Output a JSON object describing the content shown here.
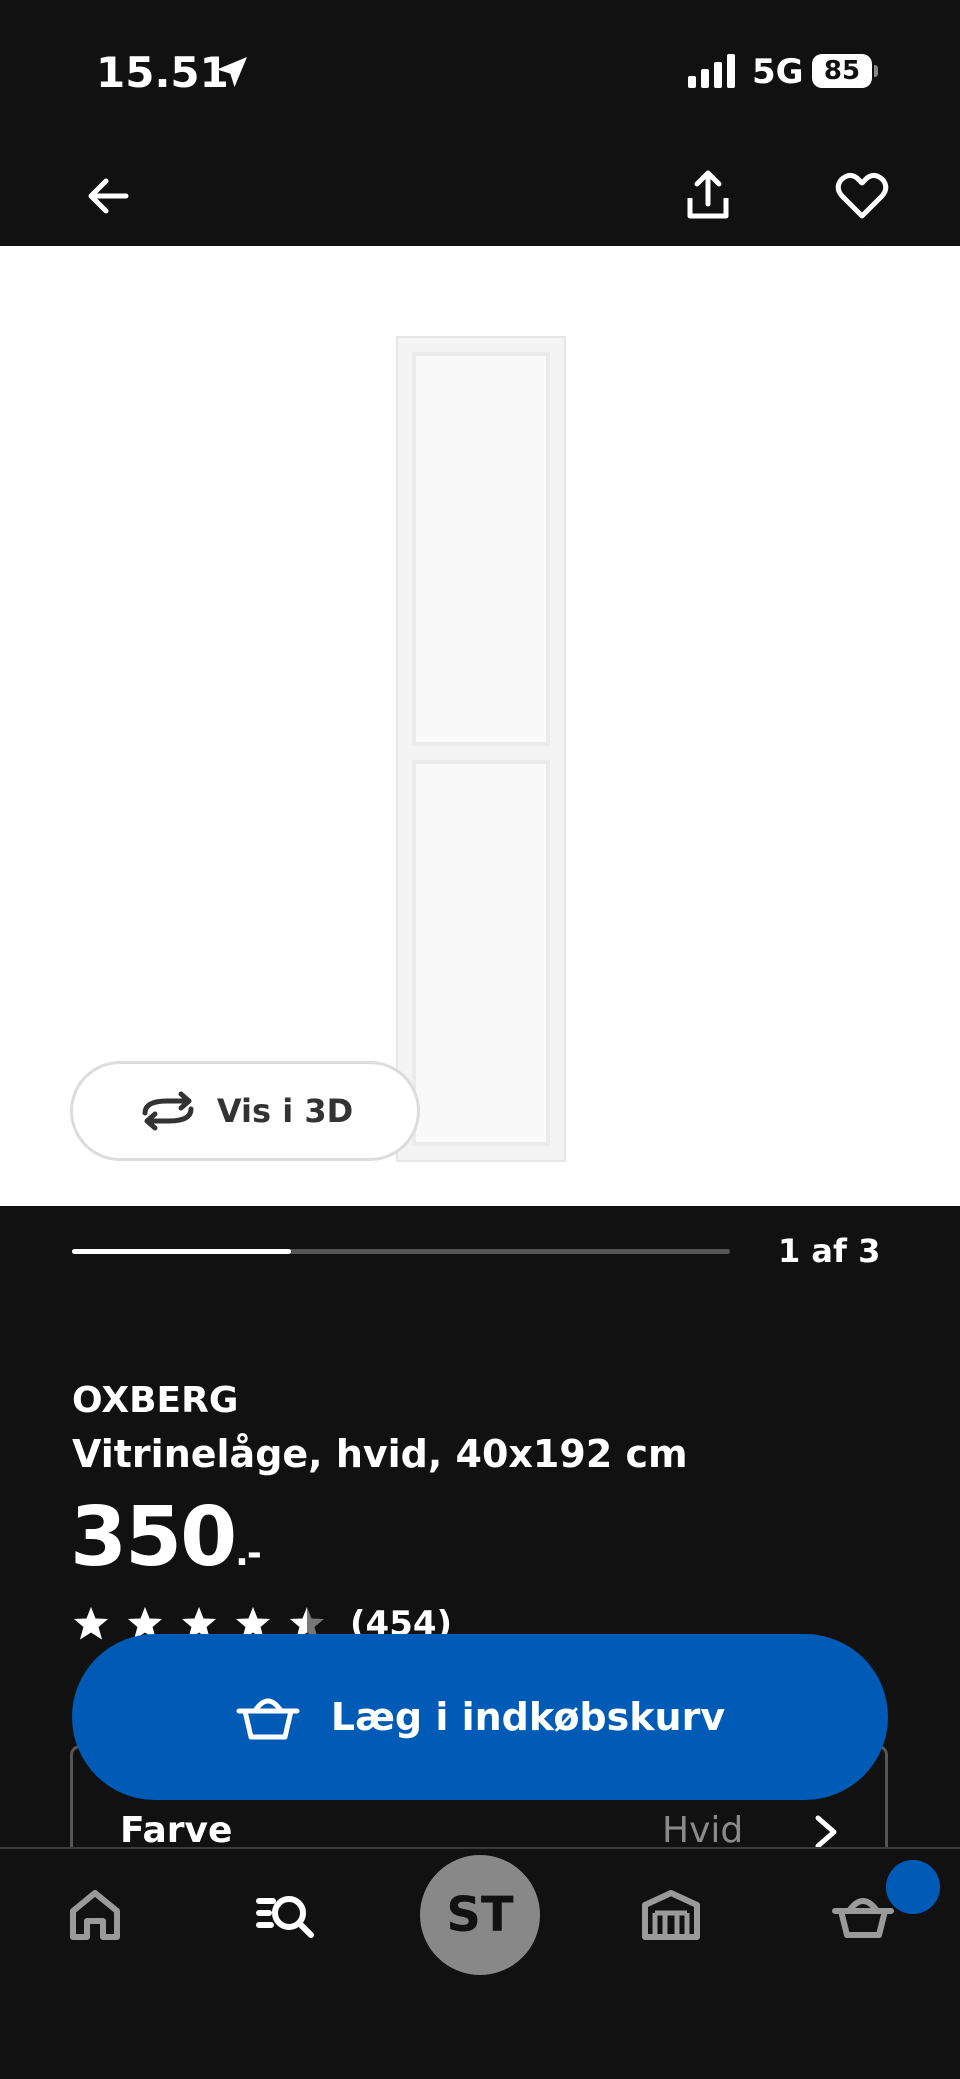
{
  "status_bar": {
    "time": "15.51",
    "network": "5G",
    "battery": "85"
  },
  "app_bar": {
    "icons": [
      "arrow-left-icon",
      "share-icon",
      "heart-icon"
    ]
  },
  "gallery": {
    "view3d_label": "Vis i 3D",
    "counter": "1 af 3",
    "progress_fraction": 0.333
  },
  "product": {
    "brand": "OXBERG",
    "description": "Vitrinelåge, hvid, 40x192 cm",
    "price": "350",
    "price_suffix": ".-",
    "rating": 4.5,
    "review_count": "(454)"
  },
  "variant": {
    "label": "Farve",
    "value": "Hvid"
  },
  "actions": {
    "add_to_basket": "Læg i indkøbskurv"
  },
  "bottom_nav": {
    "avatar_initials": "ST",
    "items": [
      "home-icon",
      "search-icon",
      "profile-avatar",
      "store-icon",
      "basket-icon"
    ],
    "basket_badge_color": "#005bb7"
  },
  "colors": {
    "background": "#111111",
    "accent": "#005bb7"
  }
}
